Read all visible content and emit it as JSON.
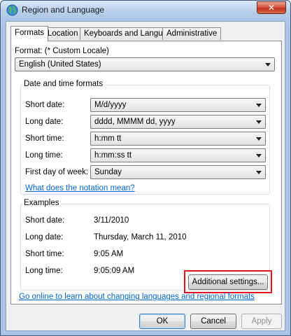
{
  "window": {
    "title": "Region and Language",
    "close_label": "✕"
  },
  "tabs": [
    {
      "label": "Formats",
      "active": true
    },
    {
      "label": "Location"
    },
    {
      "label": "Keyboards and Languages"
    },
    {
      "label": "Administrative"
    }
  ],
  "format": {
    "label": "Format: (* Custom Locale)",
    "value": "English (United States)"
  },
  "date_time_formats": {
    "group_title": "Date and time formats",
    "rows": [
      {
        "label": "Short date:",
        "value": "M/d/yyyy"
      },
      {
        "label": "Long date:",
        "value": "dddd, MMMM dd, yyyy"
      },
      {
        "label": "Short time:",
        "value": "h:mm tt"
      },
      {
        "label": "Long time:",
        "value": "h:mm:ss tt"
      },
      {
        "label": "First day of week:",
        "value": "Sunday"
      }
    ],
    "notation_link": "What does the notation mean?"
  },
  "examples": {
    "group_title": "Examples",
    "rows": [
      {
        "label": "Short date:",
        "value": "3/11/2010"
      },
      {
        "label": "Long date:",
        "value": "Thursday, March 11, 2010"
      },
      {
        "label": "Short time:",
        "value": "9:05 AM"
      },
      {
        "label": "Long time:",
        "value": "9:05:09 AM"
      }
    ]
  },
  "additional_settings_label": "Additional settings...",
  "online_link": "Go online to learn about changing languages and regional formats",
  "buttons": {
    "ok": "OK",
    "cancel": "Cancel",
    "apply": "Apply"
  },
  "colors": {
    "highlight": "#e0141c",
    "link": "#0066cc"
  }
}
